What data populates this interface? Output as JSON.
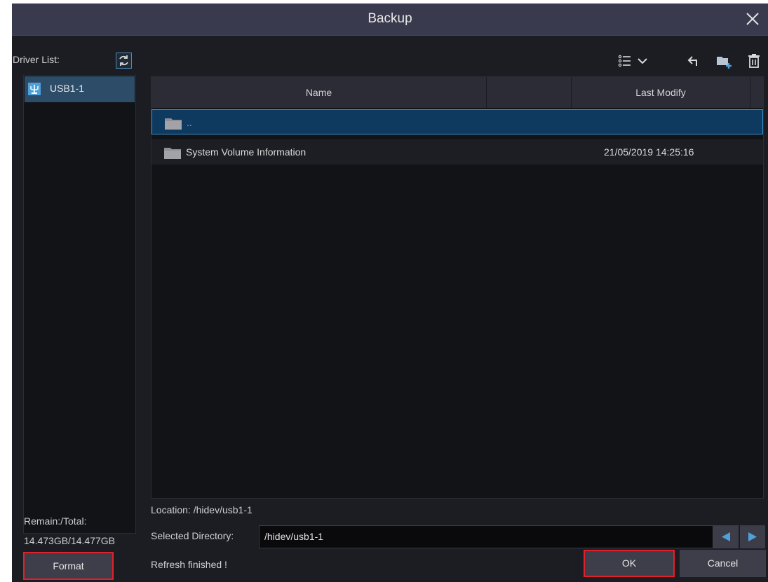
{
  "window": {
    "title": "Backup"
  },
  "drivers": {
    "label": "Driver List:",
    "items": [
      {
        "label": "USB1-1",
        "icon": "usb-icon"
      }
    ]
  },
  "storage": {
    "label": "Remain:/Total:",
    "value": "14.473GB/14.477GB"
  },
  "buttons": {
    "format": "Format",
    "ok": "OK",
    "cancel": "Cancel"
  },
  "toolbar": {
    "icons": [
      "list-view-icon",
      "chevron-down-icon",
      "back-icon",
      "new-folder-icon",
      "delete-icon"
    ]
  },
  "table": {
    "columns": [
      "Name",
      "",
      "Last Modify"
    ],
    "rows": [
      {
        "name": "..",
        "date": "",
        "selected": true
      },
      {
        "name": "System Volume Information",
        "date": "21/05/2019 14:25:16",
        "selected": false
      }
    ]
  },
  "location": "Location: /hidev/usb1-1",
  "selected_directory": {
    "label": "Selected Directory:",
    "value": "/hidev/usb1-1"
  },
  "status": "Refresh finished !",
  "colors": {
    "titlebar": "#3a3a4e",
    "background": "#1b1d23",
    "selection": "#0f3a5f",
    "accent_border": "#3a8fd0",
    "highlight_red": "#e0202a"
  }
}
